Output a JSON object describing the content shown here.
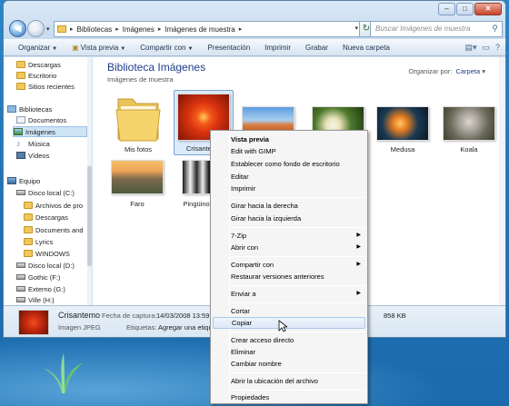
{
  "window": {
    "address": [
      "Bibliotecas",
      "Imágenes",
      "Imágenes de muestra"
    ],
    "search_placeholder": "Buscar Imágenes de muestra",
    "controls": {
      "minimize": "–",
      "maximize": "□",
      "close": "✕"
    }
  },
  "toolbar": {
    "organize": "Organizar",
    "preview": "Vista previa",
    "share": "Compartir con",
    "slideshow": "Presentación",
    "print": "Imprimir",
    "burn": "Grabar",
    "new_folder": "Nueva carpeta"
  },
  "nav": {
    "items": [
      {
        "label": "Descargas",
        "icon": "folder-icon"
      },
      {
        "label": "Escritorio",
        "icon": "folder-icon"
      },
      {
        "label": "Sitios recientes",
        "icon": "folder-icon"
      },
      {
        "label": "Bibliotecas",
        "icon": "library-icon"
      },
      {
        "label": "Documentos",
        "icon": "document-icon"
      },
      {
        "label": "Imágenes",
        "icon": "image-icon"
      },
      {
        "label": "Música",
        "icon": "music-icon"
      },
      {
        "label": "Vídeos",
        "icon": "video-icon"
      },
      {
        "label": "Equipo",
        "icon": "computer-icon"
      },
      {
        "label": "Disco local (C:)",
        "icon": "disk-icon"
      },
      {
        "label": "Archivos de pro",
        "icon": "folder-icon"
      },
      {
        "label": "Descargas",
        "icon": "folder-icon"
      },
      {
        "label": "Documents and",
        "icon": "folder-icon"
      },
      {
        "label": "Lyrics",
        "icon": "folder-icon"
      },
      {
        "label": "WINDOWS",
        "icon": "folder-icon"
      },
      {
        "label": "Disco local (D:)",
        "icon": "disk-icon"
      },
      {
        "label": "Gothic (F:)",
        "icon": "disk-icon"
      },
      {
        "label": "Externo (G:)",
        "icon": "disk-icon"
      },
      {
        "label": "Ville (H:)",
        "icon": "disk-icon"
      }
    ],
    "selected": "Imágenes"
  },
  "content": {
    "title": "Biblioteca Imágenes",
    "subtitle": "Imágenes de muestra",
    "arrange_label": "Organizar por:",
    "arrange_value": "Carpeta",
    "thumbnails": [
      {
        "label": "Mis fotos"
      },
      {
        "label": "Crisantemo"
      },
      {
        "label": ""
      },
      {
        "label": ""
      },
      {
        "label": "Medusa"
      },
      {
        "label": "Koala"
      },
      {
        "label": "Faro"
      },
      {
        "label": "Pingüinos"
      }
    ]
  },
  "details": {
    "name": "Crisantemo",
    "type": "Imagen JPEG",
    "date_label": "Fecha de captura:",
    "date_value": "14/03/2008 13:59",
    "tags_label": "Etiquetas:",
    "tags_value": "Agregar una etique",
    "size_value": "858 KB"
  },
  "context_menu": {
    "items": [
      {
        "label": "Vista previa"
      },
      {
        "label": "Edit with GIMP"
      },
      {
        "label": "Establecer como fondo de escritorio"
      },
      {
        "label": "Editar"
      },
      {
        "label": "Imprimir"
      },
      {
        "label": "Girar hacia la derecha"
      },
      {
        "label": "Girar hacia la izquierda"
      },
      {
        "label": "7-Zip"
      },
      {
        "label": "Abrir con"
      },
      {
        "label": "Compartir con"
      },
      {
        "label": "Restaurar versiones anteriores"
      },
      {
        "label": "Enviar a"
      },
      {
        "label": "Cortar"
      },
      {
        "label": "Copiar"
      },
      {
        "label": "Crear acceso directo"
      },
      {
        "label": "Eliminar"
      },
      {
        "label": "Cambiar nombre"
      },
      {
        "label": "Abrir la ubicación del archivo"
      },
      {
        "label": "Propiedades"
      }
    ],
    "hovered": "Copiar"
  }
}
